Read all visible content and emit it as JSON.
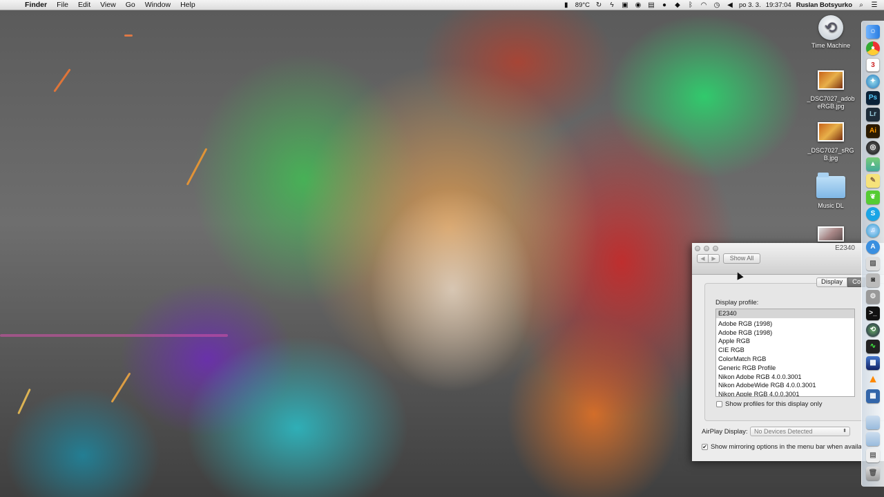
{
  "menubar": {
    "apple": "",
    "app_name": "Finder",
    "menus": [
      "File",
      "Edit",
      "View",
      "Go",
      "Window",
      "Help"
    ],
    "temperature": "89°C",
    "date": "po 3. 3.",
    "time": "19:37:04",
    "user": "Ruslan Botsyurko"
  },
  "desktop": {
    "icons": [
      {
        "label": "Time Machine",
        "icon": "time-machine-icon"
      },
      {
        "label": "_DSC7027_adobeRGB.jpg",
        "icon": "image-file-icon"
      },
      {
        "label": "_DSC7027_sRGB.jpg",
        "icon": "image-file-icon"
      },
      {
        "label": "Music DL",
        "icon": "folder-icon"
      },
      {
        "label": "",
        "icon": "image-file-icon"
      }
    ]
  },
  "window": {
    "title": "E2340",
    "show_all": "Show All",
    "back": "◀",
    "forward": "▶",
    "tabs": [
      "Display",
      "Co"
    ],
    "display_profile_label": "Display profile:",
    "profiles": [
      "E2340",
      "Adobe RGB (1998)",
      "Adobe RGB (1998)",
      "Apple RGB",
      "CIE RGB",
      "ColorMatch RGB",
      "Generic RGB Profile",
      "Nikon Adobe RGB 4.0.0.3001",
      "Nikon AdobeWide RGB 4.0.0.3001",
      "Nikon Apple RGB 4.0.0.3001"
    ],
    "selected_profile": "E2340",
    "show_profiles_only": {
      "label": "Show profiles for this display only",
      "checked": false
    },
    "airplay_label": "AirPlay Display:",
    "airplay_value": "No Devices Detected",
    "mirroring": {
      "label": "Show mirroring options in the menu bar when availa",
      "checked": true
    }
  },
  "dock": {
    "apps": [
      "Finder",
      "Chrome",
      "Calendar",
      "Safari",
      "Ps",
      "Lr",
      "Ai",
      "Aperture",
      "Maps",
      "Notes",
      "Evernote",
      "Skype",
      "iTunes",
      "App Store",
      "Preview",
      "Camera",
      "System Preferences",
      "Terminal",
      "Time Machine",
      "Activity Monitor",
      "iPhoto",
      "VLC",
      "Capture",
      "Folder",
      "Downloads",
      "Documents",
      "Trash"
    ]
  }
}
